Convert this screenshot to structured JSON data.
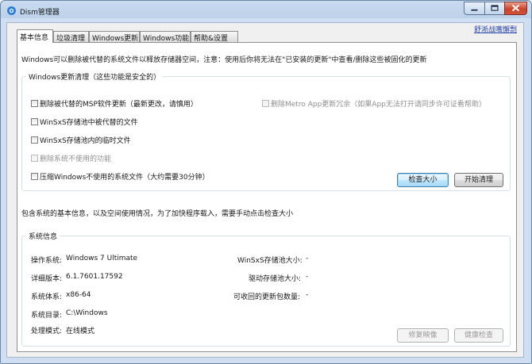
{
  "window": {
    "title": "Dism管理器"
  },
  "tabs": [
    {
      "label": "基本信息"
    },
    {
      "label": "垃圾清理"
    },
    {
      "label": "Windows更新"
    },
    {
      "label": "Windows功能"
    },
    {
      "label": "帮助&设置"
    }
  ],
  "header_link": "舒淅战嘴懈剽",
  "description_top": "Windows可以删除被代替的系统文件以释放存储器空间，注意：使用后你将无法在\"已安装的更新\"中查看/删除这些被固化的更新",
  "cleanup_group": {
    "title": "Windows更新清理（这些功能是安全的）",
    "options": [
      {
        "label": "删除被代替的MSP软件更新（最新更改，请慎用）",
        "enabled": true
      },
      {
        "label": "WinSxS存储池中被代替的文件",
        "enabled": true
      },
      {
        "label": "WinSxS存储池内的临时文件",
        "enabled": true
      },
      {
        "label": "删除系统不使用的功能",
        "enabled": false
      },
      {
        "label": "压缩Windows不使用的系统文件（大约需要30分钟）",
        "enabled": true
      }
    ],
    "right_option": {
      "label": "删除Metro App更新冗余（如果App无法打开请同步许可证看帮助）",
      "enabled": false
    },
    "check_size_button": "检查大小",
    "start_clean_button": "开始清理"
  },
  "description_mid": "包含系统的基本信息，以及空间使用情况，为了加快程序载入，需要手动点击检查大小",
  "sysinfo_group": {
    "title": "系统信息",
    "os_label": "操作系统:",
    "os_value": "Windows 7 Ultimate",
    "version_label": "详细版本:",
    "version_value": "6.1.7601.17592",
    "arch_label": "系统体系:",
    "arch_value": "x86-64",
    "dir_label": "系统目录:",
    "dir_value": "C:\\Windows",
    "mode_label": "处理模式:",
    "mode_value": "在线模式",
    "winsxs_label": "WinSxS存储池大小:",
    "winsxs_value": "-",
    "driver_label": "驱动存储池大小:",
    "driver_value": "-",
    "updates_label": "可收回的更新包数量:",
    "updates_value": "-",
    "repair_button": "修复映像",
    "health_button": "健康检查"
  }
}
